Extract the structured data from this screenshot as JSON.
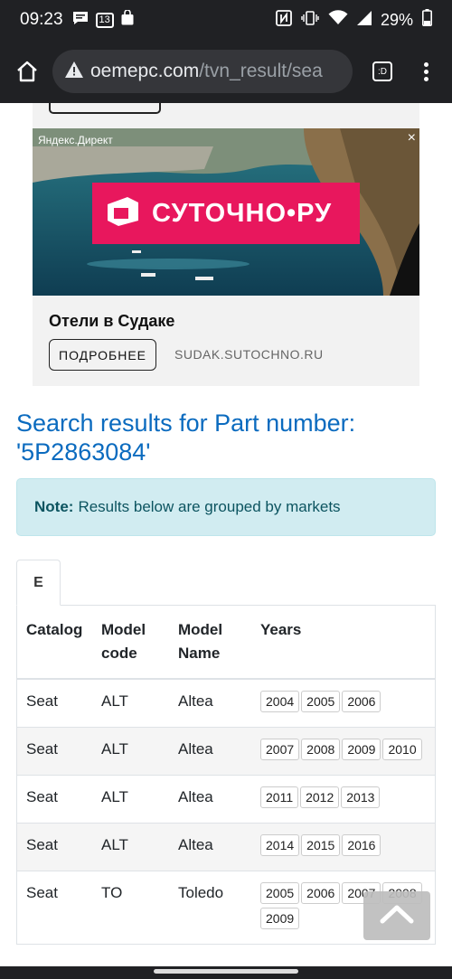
{
  "status_bar": {
    "time": "09:23",
    "notif_badge": "13",
    "battery": "29%"
  },
  "browser": {
    "url_domain": "oemepc.com",
    "url_path": "/tvn_result/sea",
    "tab_switch_label": ":D"
  },
  "ad": {
    "label": "Яндекс.Директ",
    "close": "×",
    "banner_text": "СУТОЧНО•РУ",
    "title": "Отели в Судаке",
    "button": "ПОДРОБНЕЕ",
    "domain": "SUDAK.SUTOCHNO.RU"
  },
  "heading": "Search results for Part number: '5P2863084'",
  "note": {
    "label": "Note:",
    "text": "Results below are grouped by markets"
  },
  "tabs": [
    {
      "label": "E"
    }
  ],
  "table": {
    "headers": [
      "Catalog",
      "Model code",
      "Model Name",
      "Years"
    ],
    "rows": [
      {
        "catalog": "Seat",
        "code": "ALT",
        "name": "Altea",
        "years": [
          "2004",
          "2005",
          "2006"
        ]
      },
      {
        "catalog": "Seat",
        "code": "ALT",
        "name": "Altea",
        "years": [
          "2007",
          "2008",
          "2009",
          "2010"
        ]
      },
      {
        "catalog": "Seat",
        "code": "ALT",
        "name": "Altea",
        "years": [
          "2011",
          "2012",
          "2013"
        ]
      },
      {
        "catalog": "Seat",
        "code": "ALT",
        "name": "Altea",
        "years": [
          "2014",
          "2015",
          "2016"
        ]
      },
      {
        "catalog": "Seat",
        "code": "TO",
        "name": "Toledo",
        "years": [
          "2005",
          "2006",
          "2007",
          "2008",
          "2009"
        ]
      }
    ]
  },
  "icons": [
    "home-icon",
    "warning-icon",
    "tab-switcher-icon",
    "menu-icon",
    "chevron-up-icon"
  ],
  "colors": {
    "heading": "#0b6bbf",
    "note_bg": "#d1ecf1",
    "ad_brand": "#e8175d",
    "chrome": "#202124"
  }
}
